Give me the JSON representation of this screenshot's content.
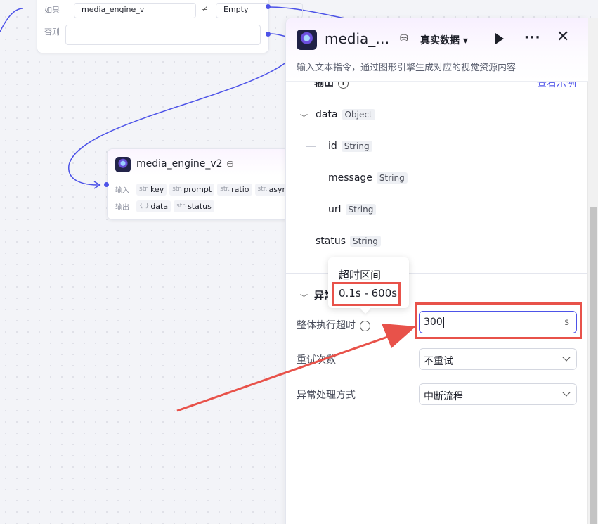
{
  "colors": {
    "accent": "#4d53e8",
    "annotation": "#e8524a"
  },
  "condition_node": {
    "if_label": "如果",
    "variable": "media_engine_v",
    "operator": "≠",
    "value": "Empty",
    "else_label": "否则"
  },
  "media_node": {
    "title": "media_engine_v2",
    "title_icon": "database-icon",
    "input_label": "输入",
    "output_label": "输出",
    "inputs": [
      {
        "type": "str.",
        "name": "key"
      },
      {
        "type": "str.",
        "name": "prompt"
      },
      {
        "type": "str.",
        "name": "ratio"
      },
      {
        "type": "str.",
        "name": "asyn"
      }
    ],
    "outputs": [
      {
        "type": "{ }",
        "name": "data"
      },
      {
        "type": "str.",
        "name": "status"
      }
    ]
  },
  "panel": {
    "title": "media_…",
    "mode": "真实数据 ▾",
    "description": "输入文本指令，通过图形引擎生成对应的视觉资源内容",
    "output_section": {
      "title": "输出",
      "example_link": "查看示例",
      "tree": [
        {
          "name": "data",
          "type": "Object"
        },
        {
          "name": "id",
          "type": "String"
        },
        {
          "name": "message",
          "type": "String"
        },
        {
          "name": "url",
          "type": "String"
        },
        {
          "name": "status",
          "type": "String"
        }
      ]
    },
    "exception_section": {
      "title": "异常",
      "timeout_label": "整体执行超时",
      "timeout_value": "300",
      "timeout_unit": "s",
      "retry_label": "重试次数",
      "retry_value": "不重试",
      "handling_label": "异常处理方式",
      "handling_value": "中断流程"
    }
  },
  "tooltip": {
    "title": "超时区间",
    "range": "0.1s - 600s"
  }
}
